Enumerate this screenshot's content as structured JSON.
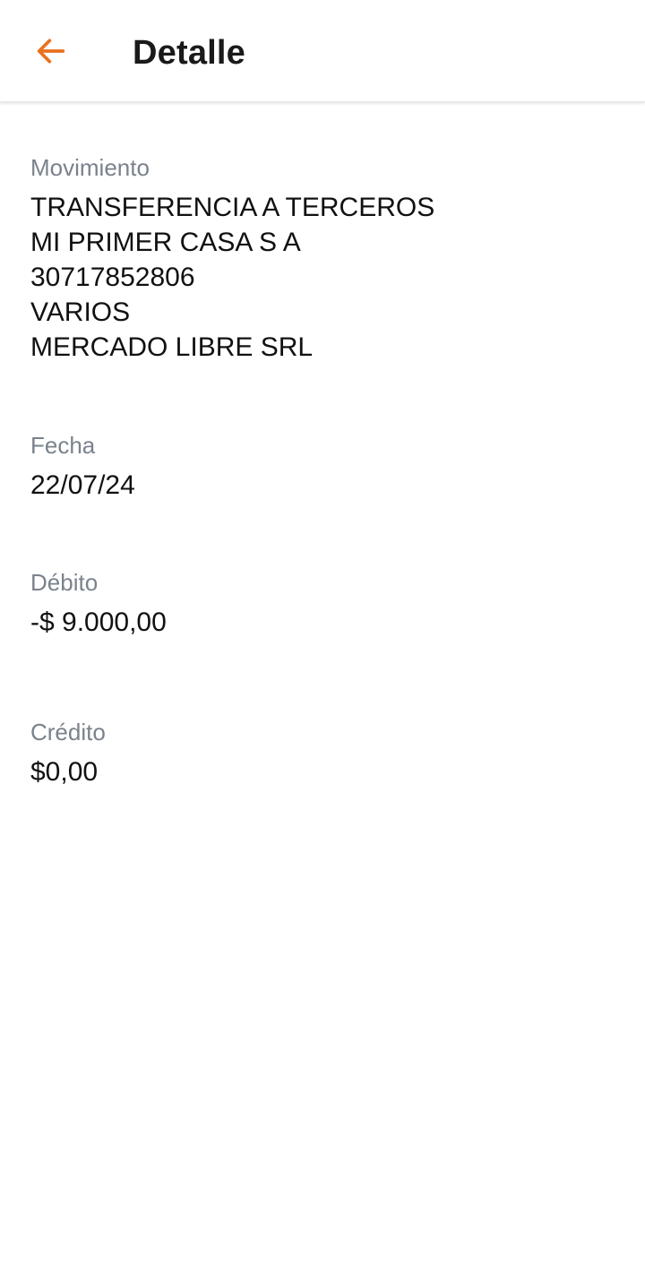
{
  "header": {
    "title": "Detalle",
    "back_icon": "arrow-left-icon",
    "accent_color": "#e8711f"
  },
  "details": {
    "movimiento": {
      "label": "Movimiento",
      "lines": [
        "TRANSFERENCIA A TERCEROS",
        "MI PRIMER CASA S A",
        "30717852806",
        "VARIOS",
        "MERCADO LIBRE SRL"
      ]
    },
    "fecha": {
      "label": "Fecha",
      "value": "22/07/24"
    },
    "debito": {
      "label": "Débito",
      "value": "-$ 9.000,00"
    },
    "credito": {
      "label": "Crédito",
      "value": "$0,00"
    }
  }
}
